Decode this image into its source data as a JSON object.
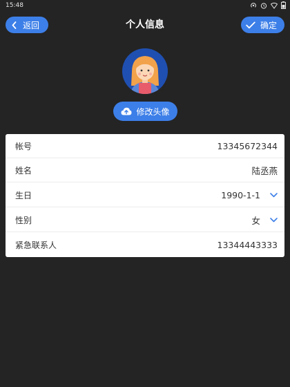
{
  "status_bar": {
    "time": "15:48"
  },
  "header": {
    "back_label": "返回",
    "title": "个人信息",
    "confirm_label": "确定"
  },
  "avatar": {
    "change_label": "修改头像"
  },
  "form": {
    "account": {
      "label": "帐号",
      "value": "13345672344"
    },
    "name": {
      "label": "姓名",
      "value": "陆丞燕"
    },
    "birthday": {
      "label": "生日",
      "value": "1990-1-1"
    },
    "gender": {
      "label": "性别",
      "value": "女"
    },
    "emergency": {
      "label": "紧急联系人",
      "value": "13344443333"
    }
  },
  "colors": {
    "background": "#242424",
    "accent": "#3d7fe8",
    "card": "#ffffff",
    "text": "#333333"
  },
  "icons": [
    "chevron-left-icon",
    "check-icon",
    "cloud-upload-icon",
    "chevron-down-icon",
    "hotspot-icon",
    "alarm-icon",
    "wifi-icon",
    "battery-icon"
  ]
}
